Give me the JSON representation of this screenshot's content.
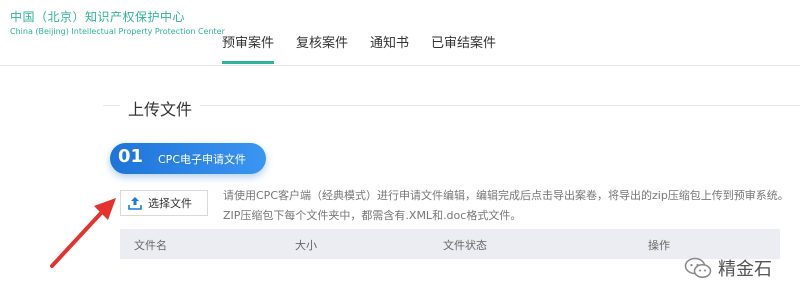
{
  "logo": {
    "cn": "中国（北京）知识产权保护中心",
    "en": "China (Beijing) Intellectual Property Protection Center"
  },
  "nav": {
    "items": [
      {
        "label": "预审案件",
        "active": true
      },
      {
        "label": "复核案件",
        "active": false
      },
      {
        "label": "通知书",
        "active": false
      },
      {
        "label": "已审结案件",
        "active": false
      }
    ]
  },
  "section": {
    "title": "上传文件"
  },
  "step": {
    "number": "01",
    "label": "CPC电子申请文件"
  },
  "upload": {
    "button_label": "选择文件",
    "icon": "upload-icon"
  },
  "hint": {
    "line1": "请使用CPC客户端（经典模式）进行申请文件编辑，编辑完成后点击导出案卷，将导出的zip压缩包上传到预审系统。",
    "line2": "ZIP压缩包下每个文件夹中，都需含有.XML和.doc格式文件。"
  },
  "table": {
    "columns": [
      "文件名",
      "大小",
      "文件状态",
      "操作"
    ]
  },
  "watermark": {
    "text": "精金石",
    "icon": "wechat-icon"
  },
  "colors": {
    "brand_green": "#2fb39a",
    "step_blue": "#1e74d8",
    "arrow_red": "#e5322d",
    "upload_blue": "#1a7ae0"
  }
}
